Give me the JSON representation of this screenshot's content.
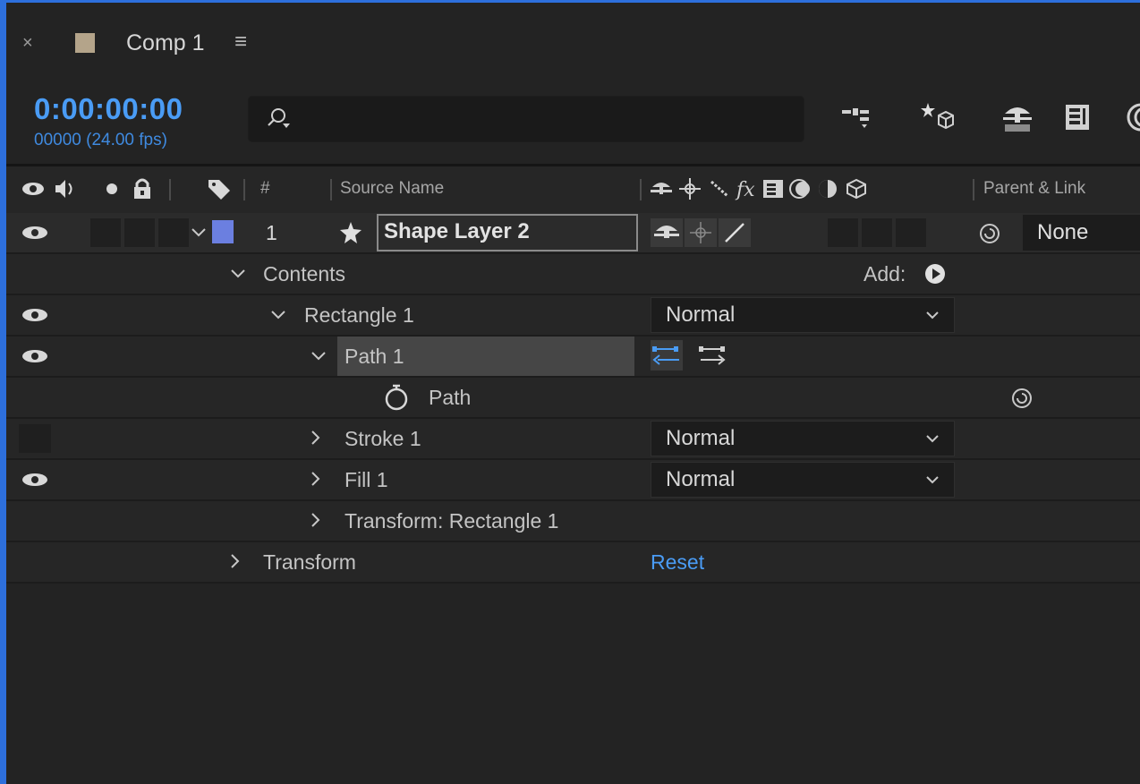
{
  "panel": {
    "close_glyph": "×",
    "comp_color": "#b4a48a",
    "title": "Comp 1",
    "menu_glyph": "≡"
  },
  "time": {
    "timecode": "0:00:00:00",
    "frames": "00000 (24.00 fps)"
  },
  "search": {
    "placeholder": "",
    "icon": "search-icon"
  },
  "toolbar_icons": [
    "comp-mini-flowchart-icon",
    "draft-3d-icon",
    "shy-layers-icon",
    "frame-blending-icon",
    "motion-blur-icon"
  ],
  "columns": {
    "number": "#",
    "source_name": "Source Name",
    "parent_link": "Parent & Link"
  },
  "layer": {
    "number": "1",
    "name": "Shape Layer 2",
    "label_color": "#6b7fe0",
    "parent": "None"
  },
  "rows": {
    "contents": "Contents",
    "add_label": "Add:",
    "rectangle": "Rectangle 1",
    "rectangle_mode": "Normal",
    "path_group": "Path 1",
    "path": "Path",
    "stroke": "Stroke 1",
    "stroke_mode": "Normal",
    "fill": "Fill 1",
    "fill_mode": "Normal",
    "transform_rect": "Transform: Rectangle 1",
    "transform": "Transform",
    "reset": "Reset"
  },
  "colors": {
    "accent": "#4a9cf5",
    "border": "#2d6fdc"
  }
}
